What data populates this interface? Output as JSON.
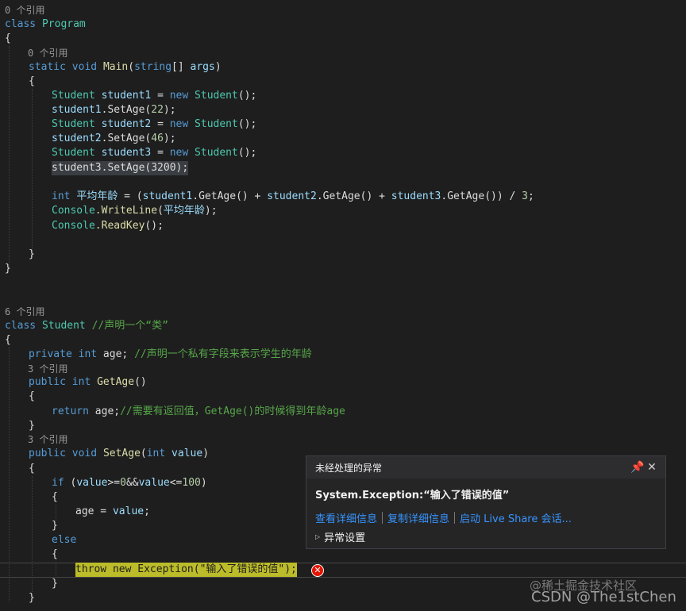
{
  "codelens": {
    "program_refs": "0 个引用",
    "main_refs": "0 个引用",
    "student_refs": "6 个引用",
    "getage_refs": "3 个引用",
    "setage_refs": "3 个引用"
  },
  "code": {
    "class_kw": "class",
    "program_name": "Program",
    "open_brace": "{",
    "close_brace": "}",
    "static_kw": "static",
    "void_kw": "void",
    "main_name": "Main",
    "main_params_open": "(",
    "string_kw": "string",
    "main_params_rest": "[] ",
    "args_name": "args",
    "main_params_close": ")",
    "student_type": "Student",
    "new_kw": "new",
    "student1_decl": "student1",
    "student2_decl": "student2",
    "student3_decl": "student3",
    "assign": " = ",
    "ctor_call": "();",
    "setage_call": ".SetAge(",
    "val1": "22",
    "val2": "46",
    "line_student3_setage": "student3.SetAge(3200);",
    "paren_close_semi": ");",
    "int_kw": "int",
    "avg_var": "平均年龄",
    "avg_expr_1": " = (",
    "student1_ref": "student1",
    "getage_call": ".GetAge",
    "getage_parens": "() + ",
    "student2_ref": "student2",
    "student3_ref": "student3",
    "avg_tail": "()) / ",
    "three": "3",
    "semi": ";",
    "console": "Console",
    "writeline": ".WriteLine",
    "writeline_args_open": "(",
    "writeline_args_close": ");",
    "readkey": ".ReadKey",
    "readkey_args": "();",
    "comment_class": "//声明一个“类”",
    "private_kw": "private",
    "age_field": " age; ",
    "comment_field": "//声明一个私有字段来表示学生的年龄",
    "public_kw": "public",
    "getage_name": "GetAge",
    "empty_parens": "()",
    "return_kw": "return",
    "age_return": " age;",
    "comment_return": "//需要有返回值，GetAge()的时候得到年龄age",
    "setage_name": "SetAge",
    "setage_params_open": "(",
    "value_param": " value",
    "setage_params_close": ")",
    "if_kw": "if",
    "if_cond_open": " (",
    "value_ref": "value",
    "cond_1": ">=",
    "zero": "0",
    "cond_and": "&&",
    "cond_2": "<=",
    "hundred": "100",
    "if_cond_close": ")",
    "age_assign": "age = ",
    "else_kw": "else",
    "throw_kw": "throw",
    "exception_type": "Exception",
    "exception_msg": "\"输入了错误的值\"",
    "throw_args_open": "(",
    "throw_args_close": ");"
  },
  "exception_popup": {
    "title": "未经处理的异常",
    "pin_icon": "pin-icon",
    "close_icon": "close-icon",
    "pin_glyph": "📌",
    "close_glyph": "✕",
    "message": "System.Exception:“输入了错误的值”",
    "link_details": "查看详细信息",
    "link_copy": "复制详细信息",
    "link_liveshare": "启动 Live Share 会话...",
    "settings_label": "异常设置",
    "settings_arrow": "▷"
  },
  "error_glyph": "error-icon",
  "error_symbol": "✕",
  "watermark": {
    "line1": "@稀土掘金技术社区",
    "line2": "CSDN @The1stChen"
  }
}
